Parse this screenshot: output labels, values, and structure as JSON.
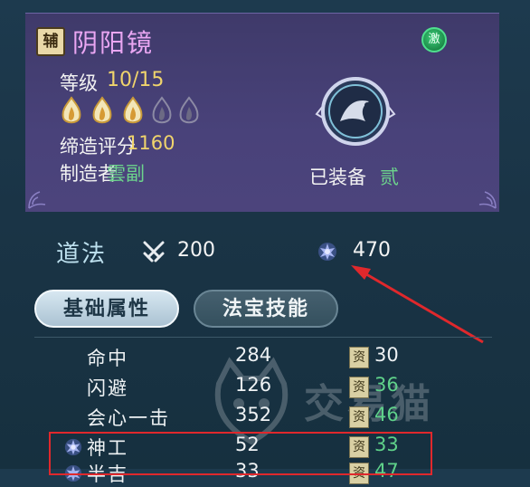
{
  "item": {
    "type_badge": "辅",
    "name": "阴阳镜",
    "ji_badge": "激",
    "level_label": "等级",
    "level_value": "10/15",
    "gems": [
      {
        "state": "lit"
      },
      {
        "state": "lit"
      },
      {
        "state": "lit"
      },
      {
        "state": "unlit"
      },
      {
        "state": "unlit"
      }
    ],
    "score_label": "缔造评分",
    "score_value": "1160",
    "maker_label": "制造者",
    "maker_value": "雲副",
    "equipped_label": "已装备",
    "equipped_value": "贰"
  },
  "stats": {
    "category": "道法",
    "attack_icon": "crossed-swords-icon",
    "attack_value": "200",
    "spirit_icon": "spirit-flower-icon",
    "spirit_value": "470"
  },
  "tabs": [
    {
      "label": "基础属性",
      "active": true
    },
    {
      "label": "法宝技能",
      "active": false
    }
  ],
  "attributes": [
    {
      "name": "命中",
      "value": "284",
      "apt_label": "资",
      "apt_value": "30",
      "apt_color": "white",
      "icon": false
    },
    {
      "name": "闪避",
      "value": "126",
      "apt_label": "资",
      "apt_value": "36",
      "apt_color": "green",
      "icon": false
    },
    {
      "name": "会心一击",
      "value": "352",
      "apt_label": "资",
      "apt_value": "46",
      "apt_color": "green",
      "icon": false
    },
    {
      "name": "神工",
      "value": "52",
      "apt_label": "资",
      "apt_value": "33",
      "apt_color": "green",
      "icon": true
    },
    {
      "name": "半吉",
      "value": "33",
      "apt_label": "资",
      "apt_value": "47",
      "apt_color": "green",
      "icon": true
    }
  ],
  "watermark": "交易猫",
  "colors": {
    "name_purple": "#e9a6f2",
    "gold": "#f0d46c",
    "green": "#5fd28a",
    "annotation_red": "#e0282c"
  }
}
